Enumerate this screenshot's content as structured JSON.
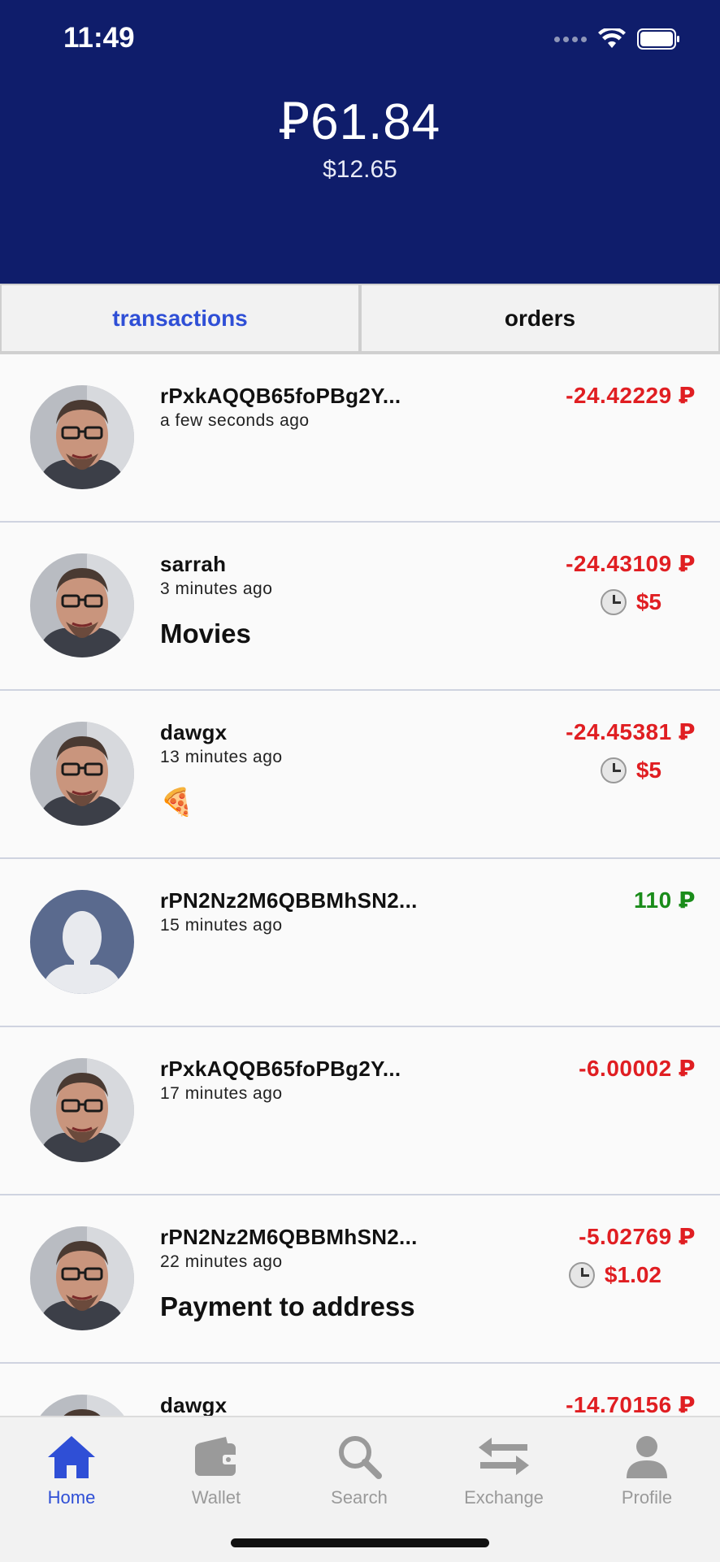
{
  "status_bar": {
    "time": "11:49"
  },
  "balance": {
    "main": "Ꝑ61.84",
    "usd": "$12.65"
  },
  "tabs": [
    {
      "label": "transactions",
      "active": true
    },
    {
      "label": "orders",
      "active": false
    }
  ],
  "transactions": [
    {
      "name": "rPxkAQQB65foPBg2Y...",
      "time": "a few seconds ago",
      "amount": "-24.42229 Ꝑ",
      "direction": "negative",
      "avatar": "photo",
      "memo": "",
      "pending": ""
    },
    {
      "name": "sarrah",
      "time": "3 minutes ago",
      "amount": "-24.43109 Ꝑ",
      "direction": "negative",
      "avatar": "photo",
      "memo": "Movies",
      "pending": "$5"
    },
    {
      "name": "dawgx",
      "time": "13 minutes ago",
      "amount": "-24.45381 Ꝑ",
      "direction": "negative",
      "avatar": "photo",
      "memo": "🍕",
      "pending": "$5"
    },
    {
      "name": "rPN2Nz2M6QBBMhSN2...",
      "time": "15 minutes ago",
      "amount": "110 Ꝑ",
      "direction": "positive",
      "avatar": "placeholder",
      "memo": "",
      "pending": ""
    },
    {
      "name": "rPxkAQQB65foPBg2Y...",
      "time": "17 minutes ago",
      "amount": "-6.00002 Ꝑ",
      "direction": "negative",
      "avatar": "photo",
      "memo": "",
      "pending": ""
    },
    {
      "name": "rPN2Nz2M6QBBMhSN2...",
      "time": "22 minutes ago",
      "amount": "-5.02769 Ꝑ",
      "direction": "negative",
      "avatar": "photo",
      "memo": "Payment to address",
      "pending": "$1.02"
    },
    {
      "name": "dawgx",
      "time": "",
      "amount": "-14.70156 Ꝑ",
      "direction": "negative",
      "avatar": "photo",
      "memo": "",
      "pending": ""
    }
  ],
  "bottom_nav": [
    {
      "label": "Home",
      "icon": "home-icon",
      "active": true
    },
    {
      "label": "Wallet",
      "icon": "wallet-icon",
      "active": false
    },
    {
      "label": "Search",
      "icon": "search-icon",
      "active": false
    },
    {
      "label": "Exchange",
      "icon": "exchange-icon",
      "active": false
    },
    {
      "label": "Profile",
      "icon": "profile-icon",
      "active": false
    }
  ],
  "colors": {
    "header": "#0f1d6b",
    "accent": "#2f4fd6",
    "negative": "#e01e22",
    "positive": "#1a8c1a",
    "inactive": "#9a9a9a"
  }
}
